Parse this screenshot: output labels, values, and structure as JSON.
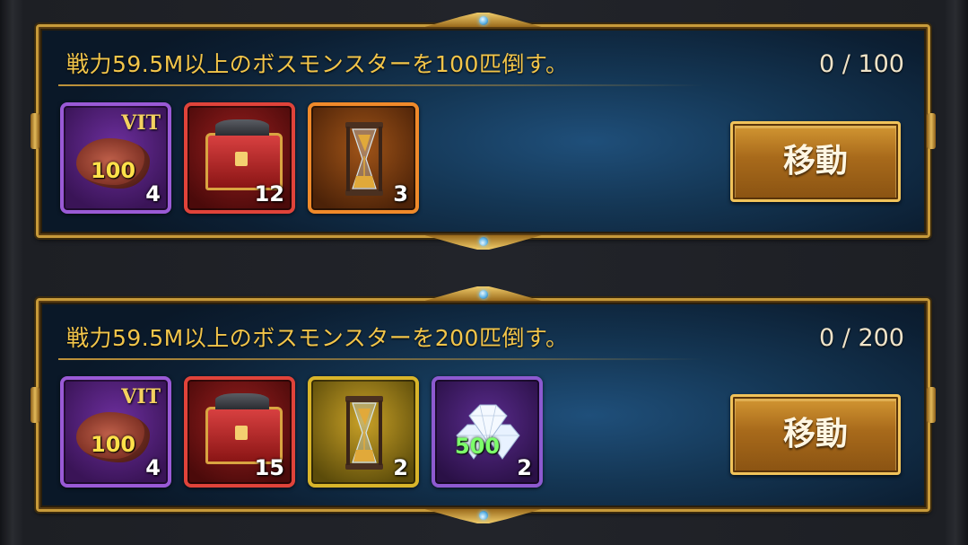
{
  "quests": [
    {
      "title": "戦力59.5M以上のボスモンスターを100匹倒す。",
      "progress": "0 / 100",
      "button_label": "移動",
      "rewards": [
        {
          "icon": "vit-meat-icon",
          "badge": "VIT",
          "value_label": "100",
          "count": "4"
        },
        {
          "icon": "treasure-chest-icon",
          "count": "12"
        },
        {
          "icon": "hourglass-icon",
          "count": "3"
        }
      ]
    },
    {
      "title": "戦力59.5M以上のボスモンスターを200匹倒す。",
      "progress": "0 / 200",
      "button_label": "移動",
      "rewards": [
        {
          "icon": "vit-meat-icon",
          "badge": "VIT",
          "value_label": "100",
          "count": "4"
        },
        {
          "icon": "treasure-chest-icon",
          "count": "15"
        },
        {
          "icon": "hourglass-icon",
          "count": "2"
        },
        {
          "icon": "diamond-gems-icon",
          "value_label": "500",
          "count": "2"
        }
      ]
    }
  ],
  "colors": {
    "title_gold": "#f2c54a",
    "frame_gold": "#c79a3a",
    "panel_blue": "#143654",
    "button_amber": "#c2852a"
  }
}
